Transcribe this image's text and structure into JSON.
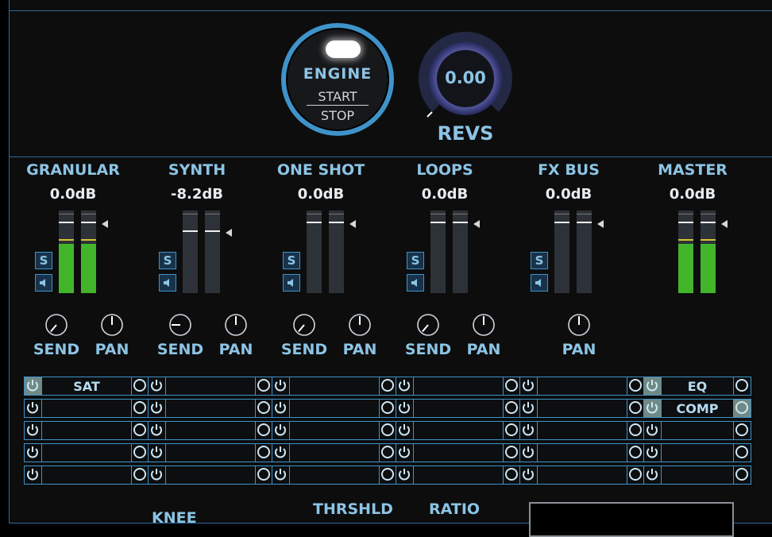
{
  "engine": {
    "title": "ENGINE",
    "start_label": "START",
    "stop_label": "STOP"
  },
  "revs": {
    "value": "0.00",
    "label": "REVS"
  },
  "channels": [
    {
      "name": "GRANULAR",
      "db": "0.0dB",
      "fader": 0.85,
      "level": 0.6,
      "send": "SEND",
      "pan": "PAN"
    },
    {
      "name": "SYNTH",
      "db": "-8.2dB",
      "fader": 0.74,
      "level": 0.0,
      "send": "SEND",
      "pan": "PAN"
    },
    {
      "name": "ONE SHOT",
      "db": "0.0dB",
      "fader": 0.85,
      "level": 0.0,
      "send": "SEND",
      "pan": "PAN"
    },
    {
      "name": "LOOPS",
      "db": "0.0dB",
      "fader": 0.85,
      "level": 0.0,
      "send": "SEND",
      "pan": "PAN"
    },
    {
      "name": "FX BUS",
      "db": "0.0dB",
      "fader": 0.85,
      "level": 0.0,
      "pan": "PAN"
    },
    {
      "name": "MASTER",
      "db": "0.0dB",
      "fader": 0.85,
      "level": 0.6,
      "pan": "PAN"
    }
  ],
  "solo_label": "S",
  "fx_grid": {
    "rows": 5,
    "named_slots": [
      {
        "col": 0,
        "row": 0,
        "name": "SAT"
      },
      {
        "col": 5,
        "row": 0,
        "name": "EQ"
      },
      {
        "col": 5,
        "row": 1,
        "name": "COMP"
      }
    ]
  },
  "bottom": {
    "knee": "KNEE",
    "threshold": "THRSHLD",
    "ratio": "RATIO"
  },
  "colors": {
    "accent": "#3f93c9",
    "label": "#8cc4e4",
    "meter_green": "#43b52b",
    "meter_yellow": "#d4c332"
  }
}
